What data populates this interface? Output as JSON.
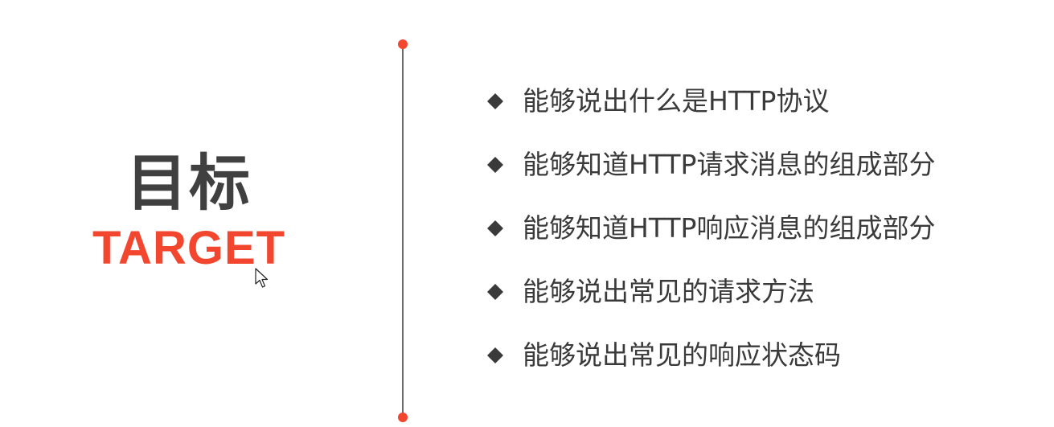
{
  "title": {
    "cn": "目标",
    "en": "TARGET"
  },
  "colors": {
    "accent": "#f2462f",
    "heading": "#404040",
    "text": "#3a3a3a",
    "divider": "#6b6b6b"
  },
  "goals": [
    {
      "text": "能够说出什么是HTTP协议",
      "icon": "diamond-bullet-icon"
    },
    {
      "text": "能够知道HTTP请求消息的组成部分",
      "icon": "diamond-bullet-icon"
    },
    {
      "text": "能够知道HTTP响应消息的组成部分",
      "icon": "diamond-bullet-icon"
    },
    {
      "text": "能够说出常见的请求方法",
      "icon": "diamond-bullet-icon"
    },
    {
      "text": "能够说出常见的响应状态码",
      "icon": "diamond-bullet-icon"
    }
  ],
  "cursor_icon": "mouse-pointer-icon"
}
